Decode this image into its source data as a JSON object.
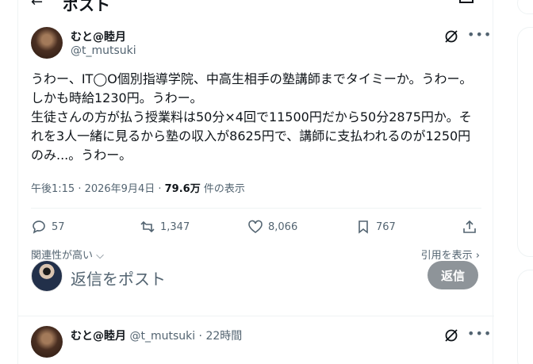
{
  "header": {
    "title": "ポスト"
  },
  "tweet": {
    "display_name": "むと@睦月",
    "handle": "@t_mutsuki",
    "text": "うわー、IT◯O個別指導学院、中高生相手の塾講師までタイミーか。うわー。しかも時給1230円。うわー。\n生徒さんの方が払う授業料は50分×4回で11500円だから50分2875円か。それを3人一緒に見るから塾の収入が8625円で、講師に支払われるのが1250円のみ...。うわー。",
    "time": "午後1:15 · 2026年9月4日 · ",
    "views": "79.6万",
    "views_label": " 件の表示",
    "replies": "57",
    "reposts": "1,347",
    "likes": "8,066",
    "bookmarks": "767",
    "sort_label": "関連性が高い",
    "quotes_label": "引用を表示"
  },
  "reply": {
    "placeholder": "返信をポスト",
    "button": "返信"
  },
  "next_tweet": {
    "display_name": "むと@睦月",
    "meta": " @t_mutsuki · 22時間"
  },
  "colors": {
    "secondary_text": "#536471",
    "disabled_button": "#8e9499",
    "divider": "#eff3f4"
  }
}
